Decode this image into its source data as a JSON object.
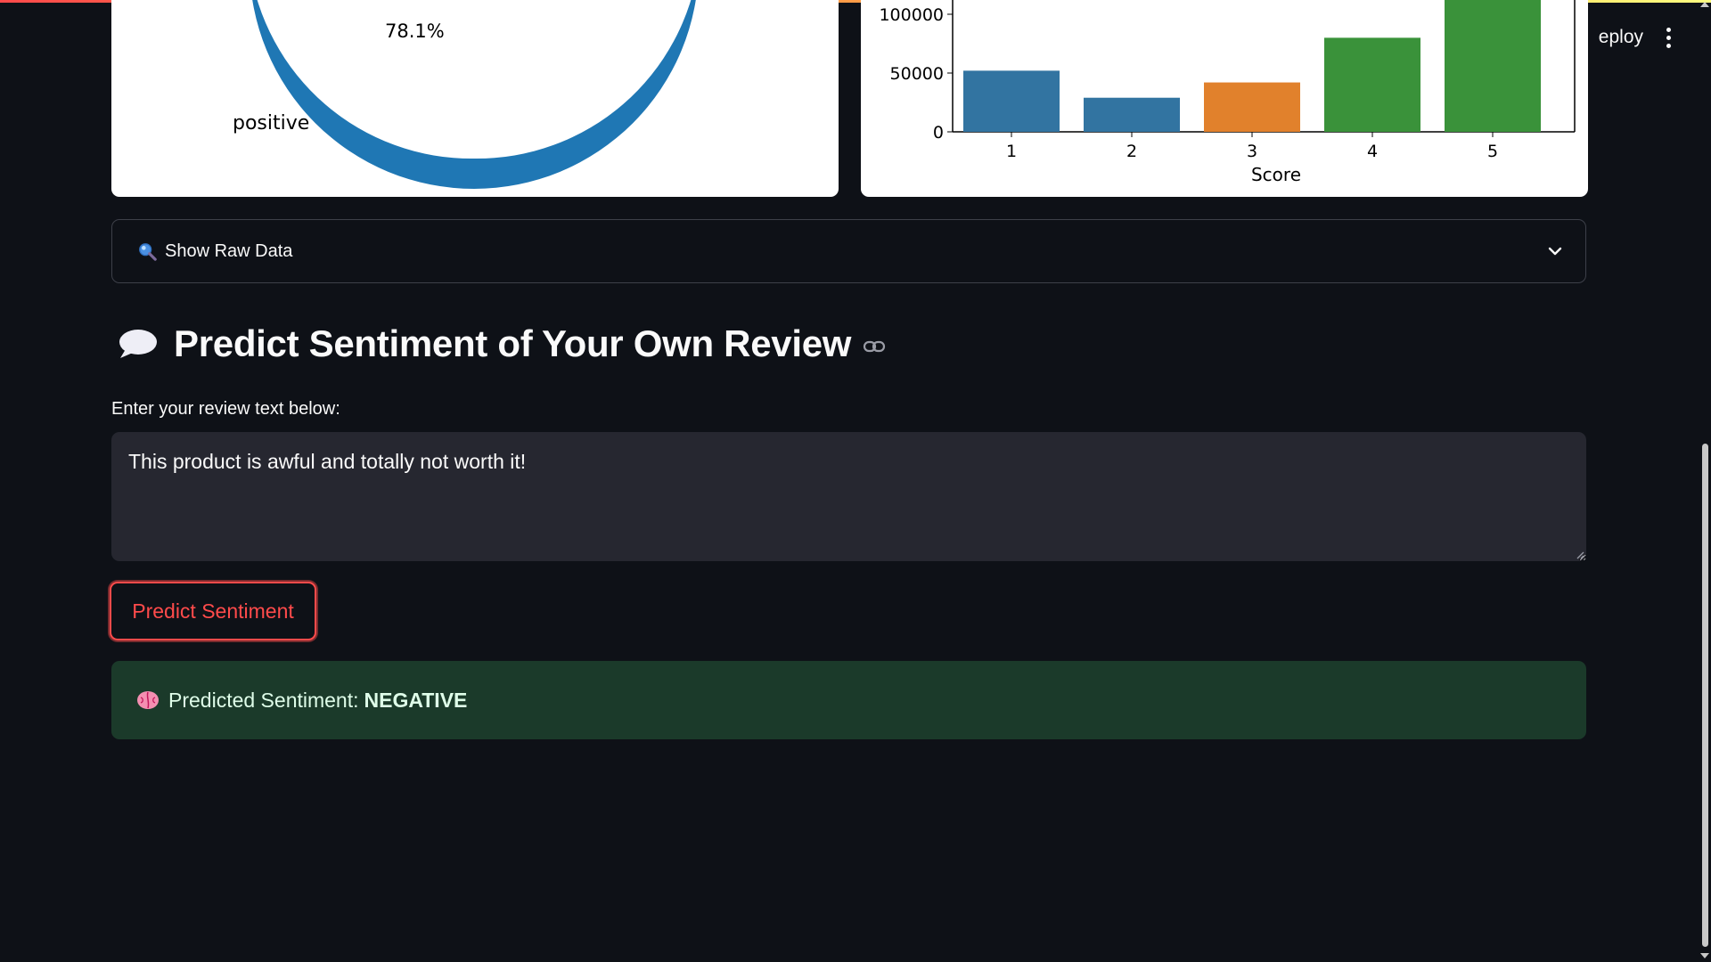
{
  "header": {
    "deploy_label": "eploy"
  },
  "pie_chart": {
    "pct_label": "78.1%",
    "slice_label": "positive"
  },
  "chart_data": [
    {
      "type": "pie",
      "categories": [
        "positive"
      ],
      "values": [
        78.1
      ],
      "data_labels": [
        "78.1%"
      ],
      "colors": [
        "#1f77b4"
      ]
    },
    {
      "type": "bar",
      "categories": [
        "1",
        "2",
        "3",
        "4",
        "5"
      ],
      "values": [
        52000,
        29000,
        42000,
        80000,
        140000
      ],
      "xlabel": "Score",
      "ylabel": "",
      "yticks": [
        "100000",
        "50000",
        "0"
      ],
      "bar_colors": [
        "#3274a1",
        "#3274a1",
        "#e1812c",
        "#3a923a",
        "#3a923a"
      ]
    }
  ],
  "expander": {
    "label": "Show Raw Data",
    "icon": "magnifier-icon"
  },
  "section": {
    "title": "Predict Sentiment of Your Own Review",
    "icon": "speech-balloon-icon"
  },
  "review_input": {
    "label": "Enter your review text below:",
    "value": "This product is awful and totally not worth it!"
  },
  "predict_button": {
    "label": "Predict Sentiment"
  },
  "result": {
    "prefix": "Predicted Sentiment:",
    "value": "NEGATIVE",
    "icon": "brain-icon"
  },
  "colors": {
    "background": "#0e1117",
    "accent": "#ff4b4b",
    "success_bg": "#1b3a2a",
    "input_bg": "#262730"
  }
}
